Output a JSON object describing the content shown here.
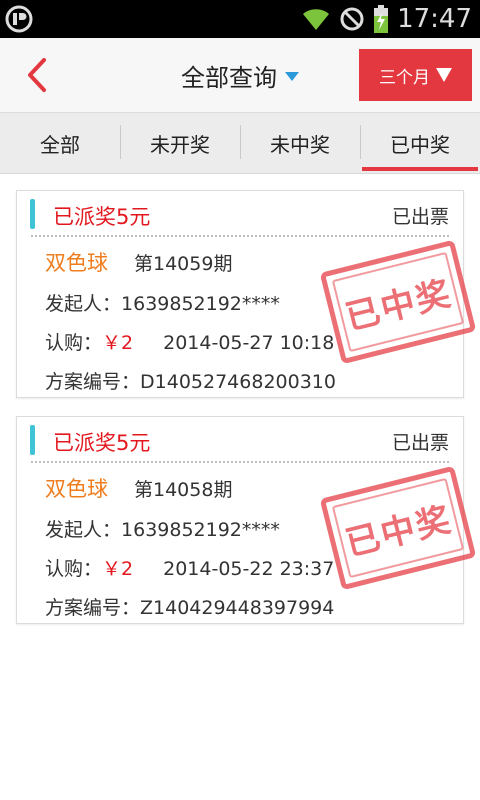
{
  "status_bar": {
    "time": "17:47"
  },
  "header": {
    "title": "全部查询",
    "range_label": "三个月"
  },
  "tabs": [
    {
      "label": "全部",
      "active": false
    },
    {
      "label": "未开奖",
      "active": false
    },
    {
      "label": "未中奖",
      "active": false
    },
    {
      "label": "已中奖",
      "active": true
    }
  ],
  "records": [
    {
      "award": "已派奖5元",
      "ticket_status": "已出票",
      "lottery": "双色球",
      "issue": "第14059期",
      "initiator_label": "发起人：",
      "initiator": "1639852192****",
      "buy_label": "认购：",
      "amount": "￥2",
      "datetime": "2014-05-27 10:18",
      "plan_label": "方案编号：",
      "plan_no": "D140527468200310",
      "stamp": "已中奖"
    },
    {
      "award": "已派奖5元",
      "ticket_status": "已出票",
      "lottery": "双色球",
      "issue": "第14058期",
      "initiator_label": "发起人：",
      "initiator": "1639852192****",
      "buy_label": "认购：",
      "amount": "￥2",
      "datetime": "2014-05-22 23:37",
      "plan_label": "方案编号：",
      "plan_no": "Z140429448397994",
      "stamp": "已中奖"
    }
  ],
  "colors": {
    "accent": "#e3383f",
    "award_text": "#e3181f",
    "lottery_text": "#ef7d1d",
    "indicator": "#3ec4d6",
    "title_caret": "#2a9ad8"
  }
}
